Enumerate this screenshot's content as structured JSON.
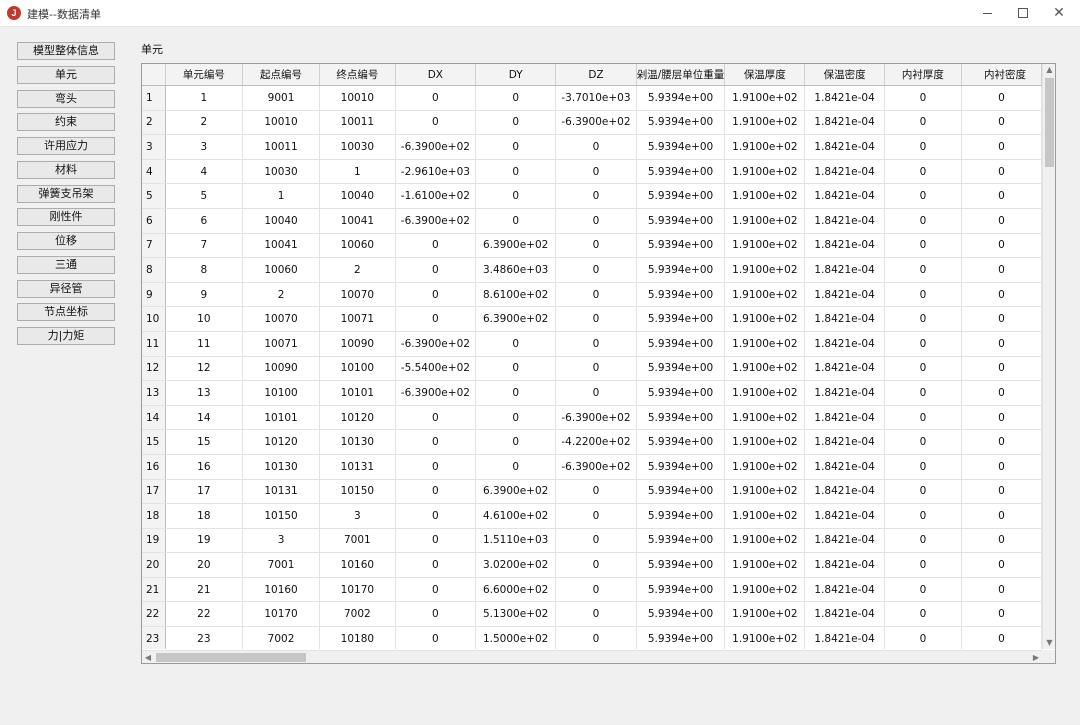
{
  "window": {
    "title": "建模--数据清单",
    "icon_letter": "J",
    "minimize": "minimize",
    "maximize": "maximize",
    "close": "✕"
  },
  "nav": {
    "items": [
      {
        "label": "模型整体信息"
      },
      {
        "label": "单元"
      },
      {
        "label": "弯头"
      },
      {
        "label": "约束"
      },
      {
        "label": "许用应力"
      },
      {
        "label": "材料"
      },
      {
        "label": "弹簧支吊架"
      },
      {
        "label": "刚性件"
      },
      {
        "label": "位移"
      },
      {
        "label": "三通"
      },
      {
        "label": "异径管"
      },
      {
        "label": "节点坐标"
      },
      {
        "label": "力|力矩"
      }
    ]
  },
  "section": {
    "label": "单元"
  },
  "table": {
    "headers": [
      "单元编号",
      "起点编号",
      "终点编号",
      "DX",
      "DY",
      "DZ",
      "保温/腰层单位重量",
      "保温厚度",
      "保温密度",
      "内衬厚度",
      "内衬密度"
    ],
    "header_display": [
      "单元编号",
      "起点编号",
      "终点编号",
      "DX",
      "DY",
      "DZ",
      "剁温/腰层单位重量",
      "保温厚度",
      "保温密度",
      "内衬厚度",
      "内衬密度"
    ],
    "rows": [
      [
        "1",
        "1",
        "9001",
        "10010",
        "0",
        "0",
        "-3.7010e+03",
        "5.9394e+00",
        "1.9100e+02",
        "1.8421e-04",
        "0",
        "0"
      ],
      [
        "2",
        "2",
        "10010",
        "10011",
        "0",
        "0",
        "-6.3900e+02",
        "5.9394e+00",
        "1.9100e+02",
        "1.8421e-04",
        "0",
        "0"
      ],
      [
        "3",
        "3",
        "10011",
        "10030",
        "-6.3900e+02",
        "0",
        "0",
        "5.9394e+00",
        "1.9100e+02",
        "1.8421e-04",
        "0",
        "0"
      ],
      [
        "4",
        "4",
        "10030",
        "1",
        "-2.9610e+03",
        "0",
        "0",
        "5.9394e+00",
        "1.9100e+02",
        "1.8421e-04",
        "0",
        "0"
      ],
      [
        "5",
        "5",
        "1",
        "10040",
        "-1.6100e+02",
        "0",
        "0",
        "5.9394e+00",
        "1.9100e+02",
        "1.8421e-04",
        "0",
        "0"
      ],
      [
        "6",
        "6",
        "10040",
        "10041",
        "-6.3900e+02",
        "0",
        "0",
        "5.9394e+00",
        "1.9100e+02",
        "1.8421e-04",
        "0",
        "0"
      ],
      [
        "7",
        "7",
        "10041",
        "10060",
        "0",
        "6.3900e+02",
        "0",
        "5.9394e+00",
        "1.9100e+02",
        "1.8421e-04",
        "0",
        "0"
      ],
      [
        "8",
        "8",
        "10060",
        "2",
        "0",
        "3.4860e+03",
        "0",
        "5.9394e+00",
        "1.9100e+02",
        "1.8421e-04",
        "0",
        "0"
      ],
      [
        "9",
        "9",
        "2",
        "10070",
        "0",
        "8.6100e+02",
        "0",
        "5.9394e+00",
        "1.9100e+02",
        "1.8421e-04",
        "0",
        "0"
      ],
      [
        "10",
        "10",
        "10070",
        "10071",
        "0",
        "6.3900e+02",
        "0",
        "5.9394e+00",
        "1.9100e+02",
        "1.8421e-04",
        "0",
        "0"
      ],
      [
        "11",
        "11",
        "10071",
        "10090",
        "-6.3900e+02",
        "0",
        "0",
        "5.9394e+00",
        "1.9100e+02",
        "1.8421e-04",
        "0",
        "0"
      ],
      [
        "12",
        "12",
        "10090",
        "10100",
        "-5.5400e+02",
        "0",
        "0",
        "5.9394e+00",
        "1.9100e+02",
        "1.8421e-04",
        "0",
        "0"
      ],
      [
        "13",
        "13",
        "10100",
        "10101",
        "-6.3900e+02",
        "0",
        "0",
        "5.9394e+00",
        "1.9100e+02",
        "1.8421e-04",
        "0",
        "0"
      ],
      [
        "14",
        "14",
        "10101",
        "10120",
        "0",
        "0",
        "-6.3900e+02",
        "5.9394e+00",
        "1.9100e+02",
        "1.8421e-04",
        "0",
        "0"
      ],
      [
        "15",
        "15",
        "10120",
        "10130",
        "0",
        "0",
        "-4.2200e+02",
        "5.9394e+00",
        "1.9100e+02",
        "1.8421e-04",
        "0",
        "0"
      ],
      [
        "16",
        "16",
        "10130",
        "10131",
        "0",
        "0",
        "-6.3900e+02",
        "5.9394e+00",
        "1.9100e+02",
        "1.8421e-04",
        "0",
        "0"
      ],
      [
        "17",
        "17",
        "10131",
        "10150",
        "0",
        "6.3900e+02",
        "0",
        "5.9394e+00",
        "1.9100e+02",
        "1.8421e-04",
        "0",
        "0"
      ],
      [
        "18",
        "18",
        "10150",
        "3",
        "0",
        "4.6100e+02",
        "0",
        "5.9394e+00",
        "1.9100e+02",
        "1.8421e-04",
        "0",
        "0"
      ],
      [
        "19",
        "19",
        "3",
        "7001",
        "0",
        "1.5110e+03",
        "0",
        "5.9394e+00",
        "1.9100e+02",
        "1.8421e-04",
        "0",
        "0"
      ],
      [
        "20",
        "20",
        "7001",
        "10160",
        "0",
        "3.0200e+02",
        "0",
        "5.9394e+00",
        "1.9100e+02",
        "1.8421e-04",
        "0",
        "0"
      ],
      [
        "21",
        "21",
        "10160",
        "10170",
        "0",
        "6.6000e+02",
        "0",
        "5.9394e+00",
        "1.9100e+02",
        "1.8421e-04",
        "0",
        "0"
      ],
      [
        "22",
        "22",
        "10170",
        "7002",
        "0",
        "5.1300e+02",
        "0",
        "5.9394e+00",
        "1.9100e+02",
        "1.8421e-04",
        "0",
        "0"
      ],
      [
        "23",
        "23",
        "7002",
        "10180",
        "0",
        "1.5000e+02",
        "0",
        "5.9394e+00",
        "1.9100e+02",
        "1.8421e-04",
        "0",
        "0"
      ]
    ]
  },
  "scroll": {
    "up_arrow": "▲",
    "down_arrow": "▼",
    "left_arrow": "◀",
    "right_arrow": "▶"
  }
}
